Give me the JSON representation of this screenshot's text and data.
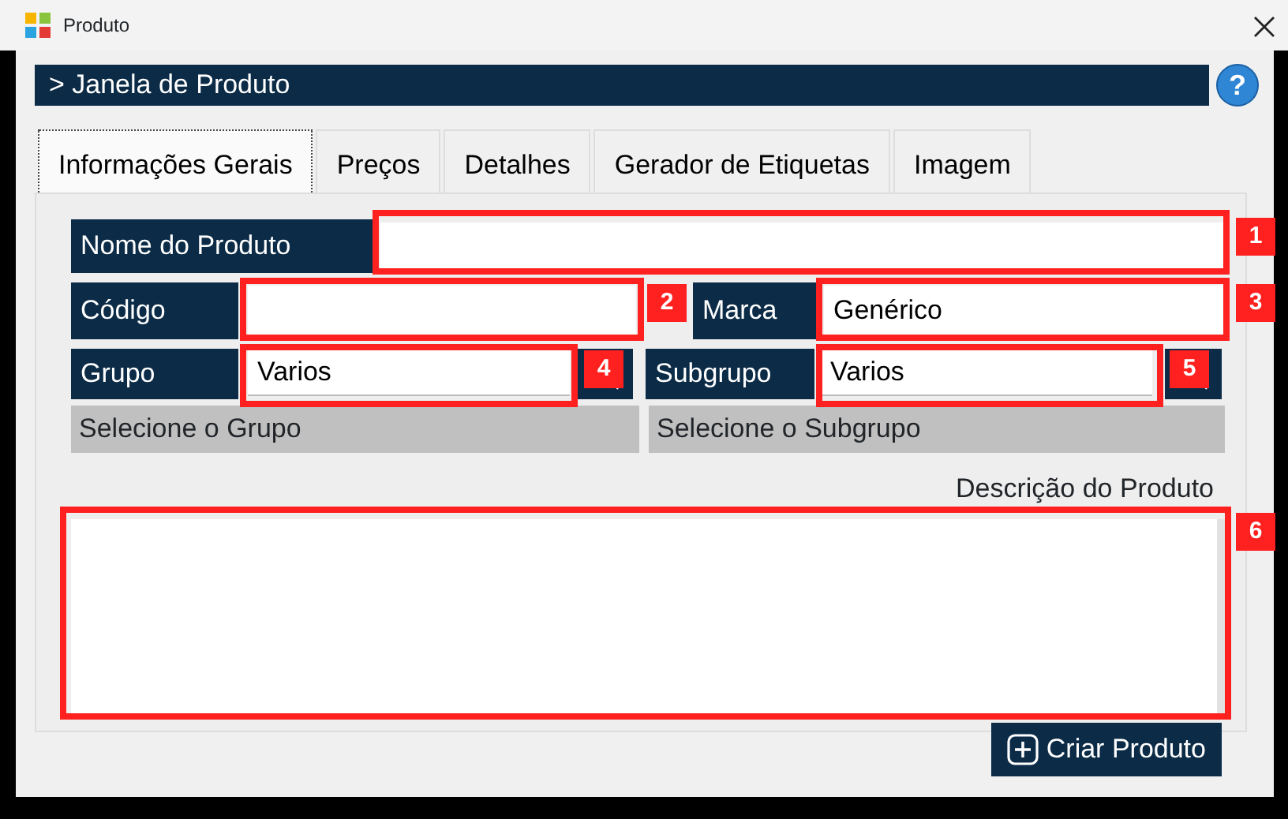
{
  "window": {
    "title": "Produto"
  },
  "header": {
    "title": "> Janela de Produto",
    "help": "?"
  },
  "tabs": [
    {
      "label": "Informações Gerais",
      "selected": true
    },
    {
      "label": "Preços",
      "selected": false
    },
    {
      "label": "Detalhes",
      "selected": false
    },
    {
      "label": "Gerador de Etiquetas",
      "selected": false
    },
    {
      "label": "Imagem",
      "selected": false
    }
  ],
  "form": {
    "nome": {
      "label": "Nome do Produto"
    },
    "codigo": {
      "label": "Código"
    },
    "marca": {
      "label": "Marca",
      "value": "Genérico"
    },
    "grupo": {
      "label": "Grupo",
      "value": "Varios",
      "hint": "Selecione o Grupo"
    },
    "subgrupo": {
      "label": "Subgrupo",
      "value": "Varios",
      "hint": "Selecione o Subgrupo"
    },
    "descricao": {
      "label": "Descrição do Produto"
    }
  },
  "button": {
    "label": "Criar Produto"
  },
  "annotations": [
    {
      "number": "1"
    },
    {
      "number": "2"
    },
    {
      "number": "3"
    },
    {
      "number": "4"
    },
    {
      "number": "5"
    },
    {
      "number": "6"
    }
  ]
}
